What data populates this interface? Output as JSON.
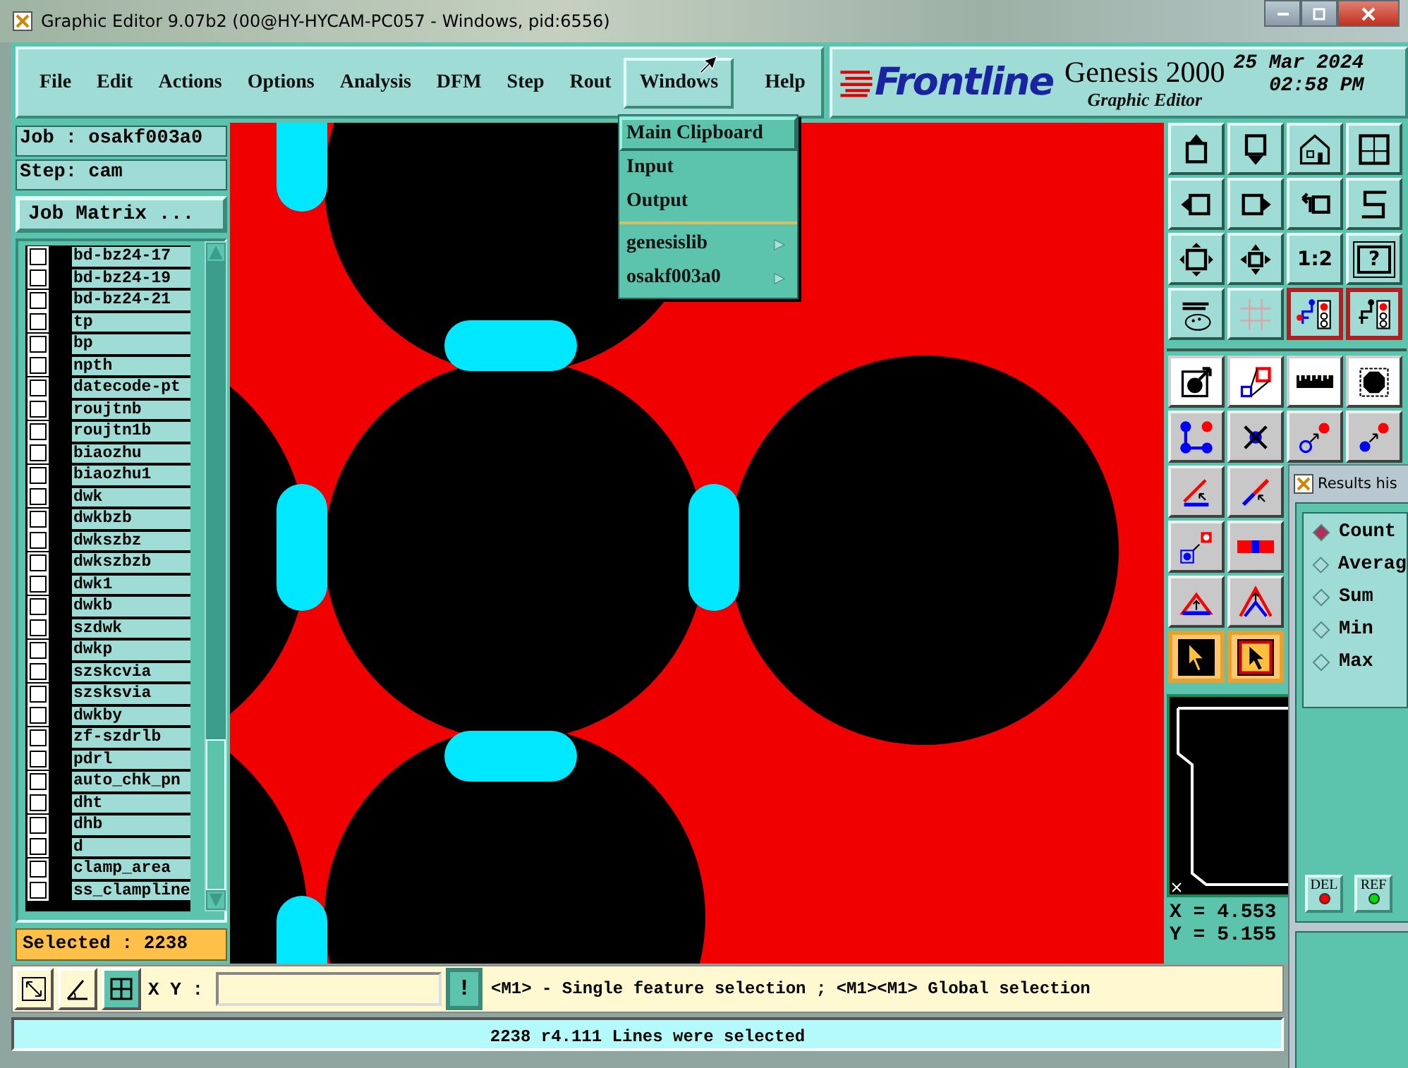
{
  "window": {
    "title": "Graphic Editor 9.07b2 (00@HY-HYCAM-PC057 - Windows, pid:6556)"
  },
  "menu": [
    {
      "label": "File",
      "selected": false
    },
    {
      "label": "Edit",
      "selected": false
    },
    {
      "label": "Actions",
      "selected": false
    },
    {
      "label": "Options",
      "selected": false
    },
    {
      "label": "Analysis",
      "selected": false
    },
    {
      "label": "DFM",
      "selected": false
    },
    {
      "label": "Step",
      "selected": false
    },
    {
      "label": "Rout",
      "selected": false
    },
    {
      "label": "Windows",
      "selected": true
    },
    {
      "label": "Help",
      "selected": false
    }
  ],
  "dropdown": [
    {
      "label": "Main Clipboard",
      "selected": true,
      "submenu": false
    },
    {
      "label": "Input",
      "selected": false,
      "submenu": false
    },
    {
      "label": "Output",
      "selected": false,
      "submenu": false
    },
    {
      "label": "genesislib",
      "selected": false,
      "submenu": true
    },
    {
      "label": "osakf003a0",
      "selected": false,
      "submenu": true
    }
  ],
  "logo": {
    "brand": "Frontline",
    "product": "Genesis 2000",
    "subtitle": "Graphic Editor",
    "date": "25 Mar 2024",
    "time": "02:58 PM"
  },
  "job": "Job : osakf003a0",
  "step": "Step: cam",
  "job_matrix_button": "Job Matrix ...",
  "layers": [
    {
      "name": "bd-bz24-17",
      "checked": false
    },
    {
      "name": "bd-bz24-19",
      "checked": false
    },
    {
      "name": "bd-bz24-21",
      "checked": false
    },
    {
      "name": "tp",
      "checked": false
    },
    {
      "name": "bp",
      "checked": false
    },
    {
      "name": "npth",
      "checked": false
    },
    {
      "name": "datecode-pt",
      "checked": false
    },
    {
      "name": "roujtnb",
      "checked": false
    },
    {
      "name": "roujtn1b",
      "checked": false
    },
    {
      "name": "biaozhu",
      "checked": false
    },
    {
      "name": "biaozhu1",
      "checked": false
    },
    {
      "name": "dwk",
      "checked": false
    },
    {
      "name": "dwkbzb",
      "checked": false
    },
    {
      "name": "dwkszbz",
      "checked": false
    },
    {
      "name": "dwkszbzb",
      "checked": false
    },
    {
      "name": "dwk1",
      "checked": false
    },
    {
      "name": "dwkb",
      "checked": false
    },
    {
      "name": "szdwk",
      "checked": false
    },
    {
      "name": "dwkp",
      "checked": false
    },
    {
      "name": "szskcvia",
      "checked": false
    },
    {
      "name": "szsksvia",
      "checked": false
    },
    {
      "name": "dwkby",
      "checked": false
    },
    {
      "name": "zf-szdrlb",
      "checked": false
    },
    {
      "name": "pdrl",
      "checked": false
    },
    {
      "name": "auto_chk_pn",
      "checked": false
    },
    {
      "name": "dht",
      "checked": false
    },
    {
      "name": "dhb",
      "checked": false
    },
    {
      "name": "d",
      "checked": false
    },
    {
      "name": "clamp_area",
      "checked": false
    },
    {
      "name": "ss_clampline",
      "checked": false
    }
  ],
  "selected_count": "Selected : 2238",
  "tools": [
    {
      "on": false
    },
    {
      "on": false
    },
    {
      "on": false
    },
    {
      "on": false
    },
    {
      "on": false
    },
    {
      "on": false
    },
    {
      "on": false
    },
    {
      "on": false
    },
    {
      "on": false
    },
    {
      "on": false
    },
    {
      "on": false,
      "label": "1:2"
    },
    {
      "on": false,
      "label": "?"
    },
    {
      "on": false
    },
    {
      "on": false
    },
    {
      "on": true
    },
    {
      "on": true
    },
    {
      "on": false
    },
    {
      "on": false
    },
    {
      "on": false
    },
    {
      "on": false
    },
    {
      "on": false
    },
    {
      "on": false
    },
    {
      "on": false
    },
    {
      "on": false
    },
    {
      "on": false
    },
    {
      "on": false
    },
    {
      "on": false
    },
    {
      "on": false
    },
    {
      "on": false
    },
    {
      "on": false
    },
    {
      "on": true
    },
    {
      "on": true
    }
  ],
  "coords": {
    "x": "X = 4.553",
    "y": "Y = 5.155"
  },
  "xy_label": "X Y :",
  "exclaim_button": "!",
  "message": "<M1> - Single feature selection ; <M1><M1> Global selection",
  "status": "2238 r4.111 Lines were selected",
  "results": {
    "title": "Results his",
    "options": [
      {
        "label": "Count",
        "selected": true
      },
      {
        "label": "Averag",
        "selected": false
      },
      {
        "label": "Sum",
        "selected": false
      },
      {
        "label": "Min",
        "selected": false
      },
      {
        "label": "Max",
        "selected": false
      }
    ],
    "buttons": [
      {
        "label": "DEL",
        "color": "#ff0000"
      },
      {
        "label": "REF",
        "color": "#00e000"
      }
    ]
  }
}
